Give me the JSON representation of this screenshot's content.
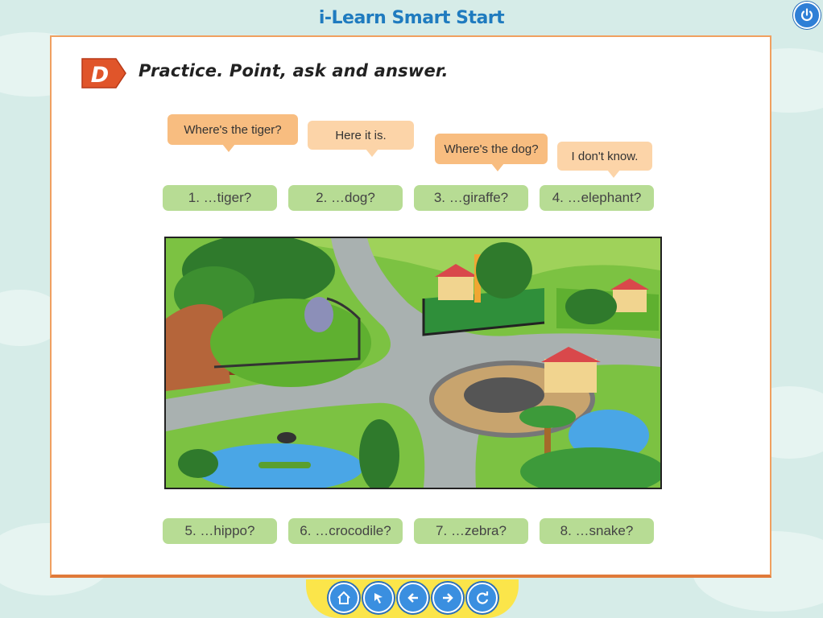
{
  "app": {
    "title": "i-Learn Smart Start"
  },
  "activity": {
    "badge": "D",
    "heading": "Practice. Point, ask and answer."
  },
  "bubbles": [
    {
      "text": "Where's the tiger?"
    },
    {
      "text": "Here it is."
    },
    {
      "text": "Where's the dog?"
    },
    {
      "text": "I don't know."
    }
  ],
  "prompts_top": [
    {
      "label": "1. …tiger?"
    },
    {
      "label": "2. …dog?"
    },
    {
      "label": "3. …giraffe?"
    },
    {
      "label": "4. …elephant?"
    }
  ],
  "prompts_bottom": [
    {
      "label": "5. …hippo?"
    },
    {
      "label": "6. …crocodile?"
    },
    {
      "label": "7. …zebra?"
    },
    {
      "label": "8. …snake?"
    }
  ],
  "nav": {
    "icons": [
      "home-icon",
      "pointer-icon",
      "back-icon",
      "forward-icon",
      "refresh-icon"
    ]
  },
  "colors": {
    "accent_orange": "#e0552a",
    "pill_green": "#b7dc94",
    "bubble_orange": "#f8bd80",
    "title_blue": "#1f7bbf"
  }
}
